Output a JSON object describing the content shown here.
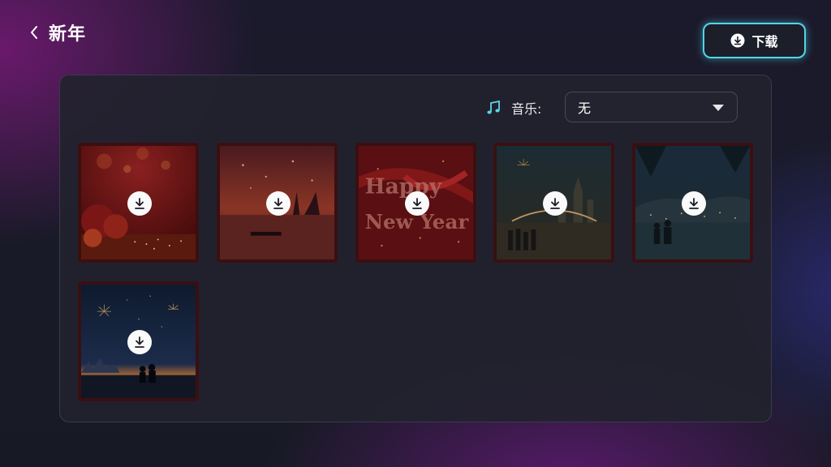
{
  "header": {
    "title": "新年",
    "back_icon": "chevron-left-icon"
  },
  "toolbar": {
    "download_label": "下载",
    "download_icon": "download-circle-icon",
    "accent": "#4fd6e8"
  },
  "music": {
    "label": "音乐:",
    "icon": "music-note-icon",
    "selected": "无"
  },
  "templates": [
    {
      "theme": "red christmas ornaments",
      "download_icon": "download-icon"
    },
    {
      "theme": "red sunset lake with boat",
      "download_icon": "download-icon"
    },
    {
      "theme": "Happy New Year red ribbon",
      "text": "Happy New Year",
      "download_icon": "download-icon"
    },
    {
      "theme": "night city fireworks bridge",
      "download_icon": "download-icon"
    },
    {
      "theme": "night lake children silhouette",
      "download_icon": "download-icon"
    },
    {
      "theme": "night fireworks skyline children",
      "download_icon": "download-icon"
    }
  ]
}
